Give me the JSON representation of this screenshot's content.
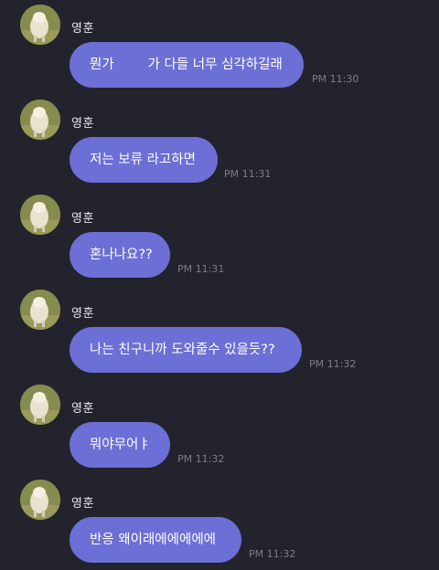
{
  "messages": [
    {
      "sender": "영훈",
      "text": "뭔가        가 다들 너무 심각하길래",
      "time": "PM 11:30"
    },
    {
      "sender": "영훈",
      "text": "저는 보류 라고하면",
      "time": "PM 11:31"
    },
    {
      "sender": "영훈",
      "text": "혼나나요??",
      "time": "PM 11:31"
    },
    {
      "sender": "영훈",
      "text": "나는 친구니까 도와줄수 있을듯??",
      "time": "PM 11:32"
    },
    {
      "sender": "영훈",
      "text": "뭐야무어ㅑ",
      "time": "PM 11:32"
    },
    {
      "sender": "영훈",
      "text": "반응 왜이래에에에에에",
      "time": "PM 11:32"
    }
  ],
  "colors": {
    "background": "#23232d",
    "bubble": "#6c6fd6",
    "time": "#7d7d86"
  },
  "icons": {
    "avatar": "lamb-photo-avatar"
  }
}
